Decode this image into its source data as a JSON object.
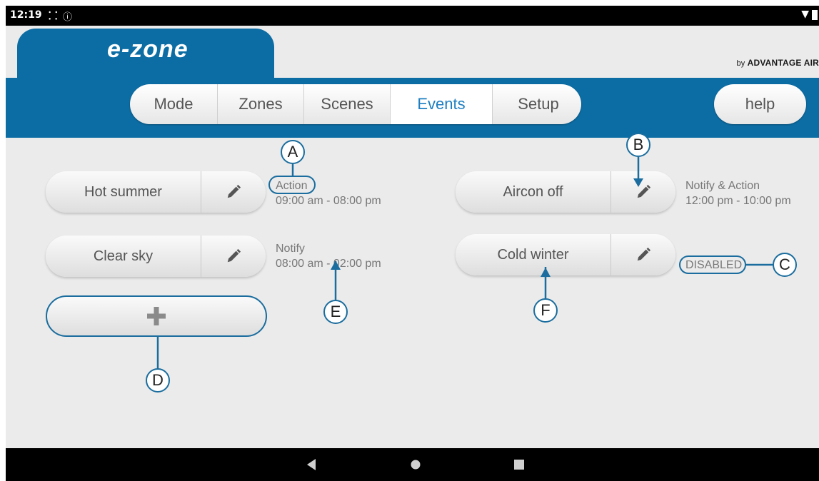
{
  "status_bar": {
    "time": "12:19"
  },
  "brand": {
    "logo": "e-zone",
    "by": "by",
    "company": "ADVANTAGE AIR"
  },
  "nav": {
    "tabs": [
      {
        "label": "Mode",
        "active": false
      },
      {
        "label": "Zones",
        "active": false
      },
      {
        "label": "Scenes",
        "active": false
      },
      {
        "label": "Events",
        "active": true
      },
      {
        "label": "Setup",
        "active": false
      }
    ],
    "help_label": "help"
  },
  "events": [
    {
      "name": "Hot summer",
      "type": "Action",
      "time": "09:00 am - 08:00 pm"
    },
    {
      "name": "Clear sky",
      "type": "Notify",
      "time": "08:00 am - 02:00 pm"
    },
    {
      "name": "Aircon off",
      "type": "Notify & Action",
      "time": "12:00 pm - 10:00 pm"
    },
    {
      "name": "Cold winter",
      "type": "DISABLED",
      "time": ""
    }
  ],
  "add_button": {
    "icon": "plus-icon"
  },
  "callouts": {
    "a": "A",
    "b": "B",
    "c": "C",
    "d": "D",
    "e": "E",
    "f": "F"
  },
  "colors": {
    "brand_blue": "#0c6da4",
    "active_tab": "#1e7fc2",
    "callout_line": "#1a6d9e"
  }
}
